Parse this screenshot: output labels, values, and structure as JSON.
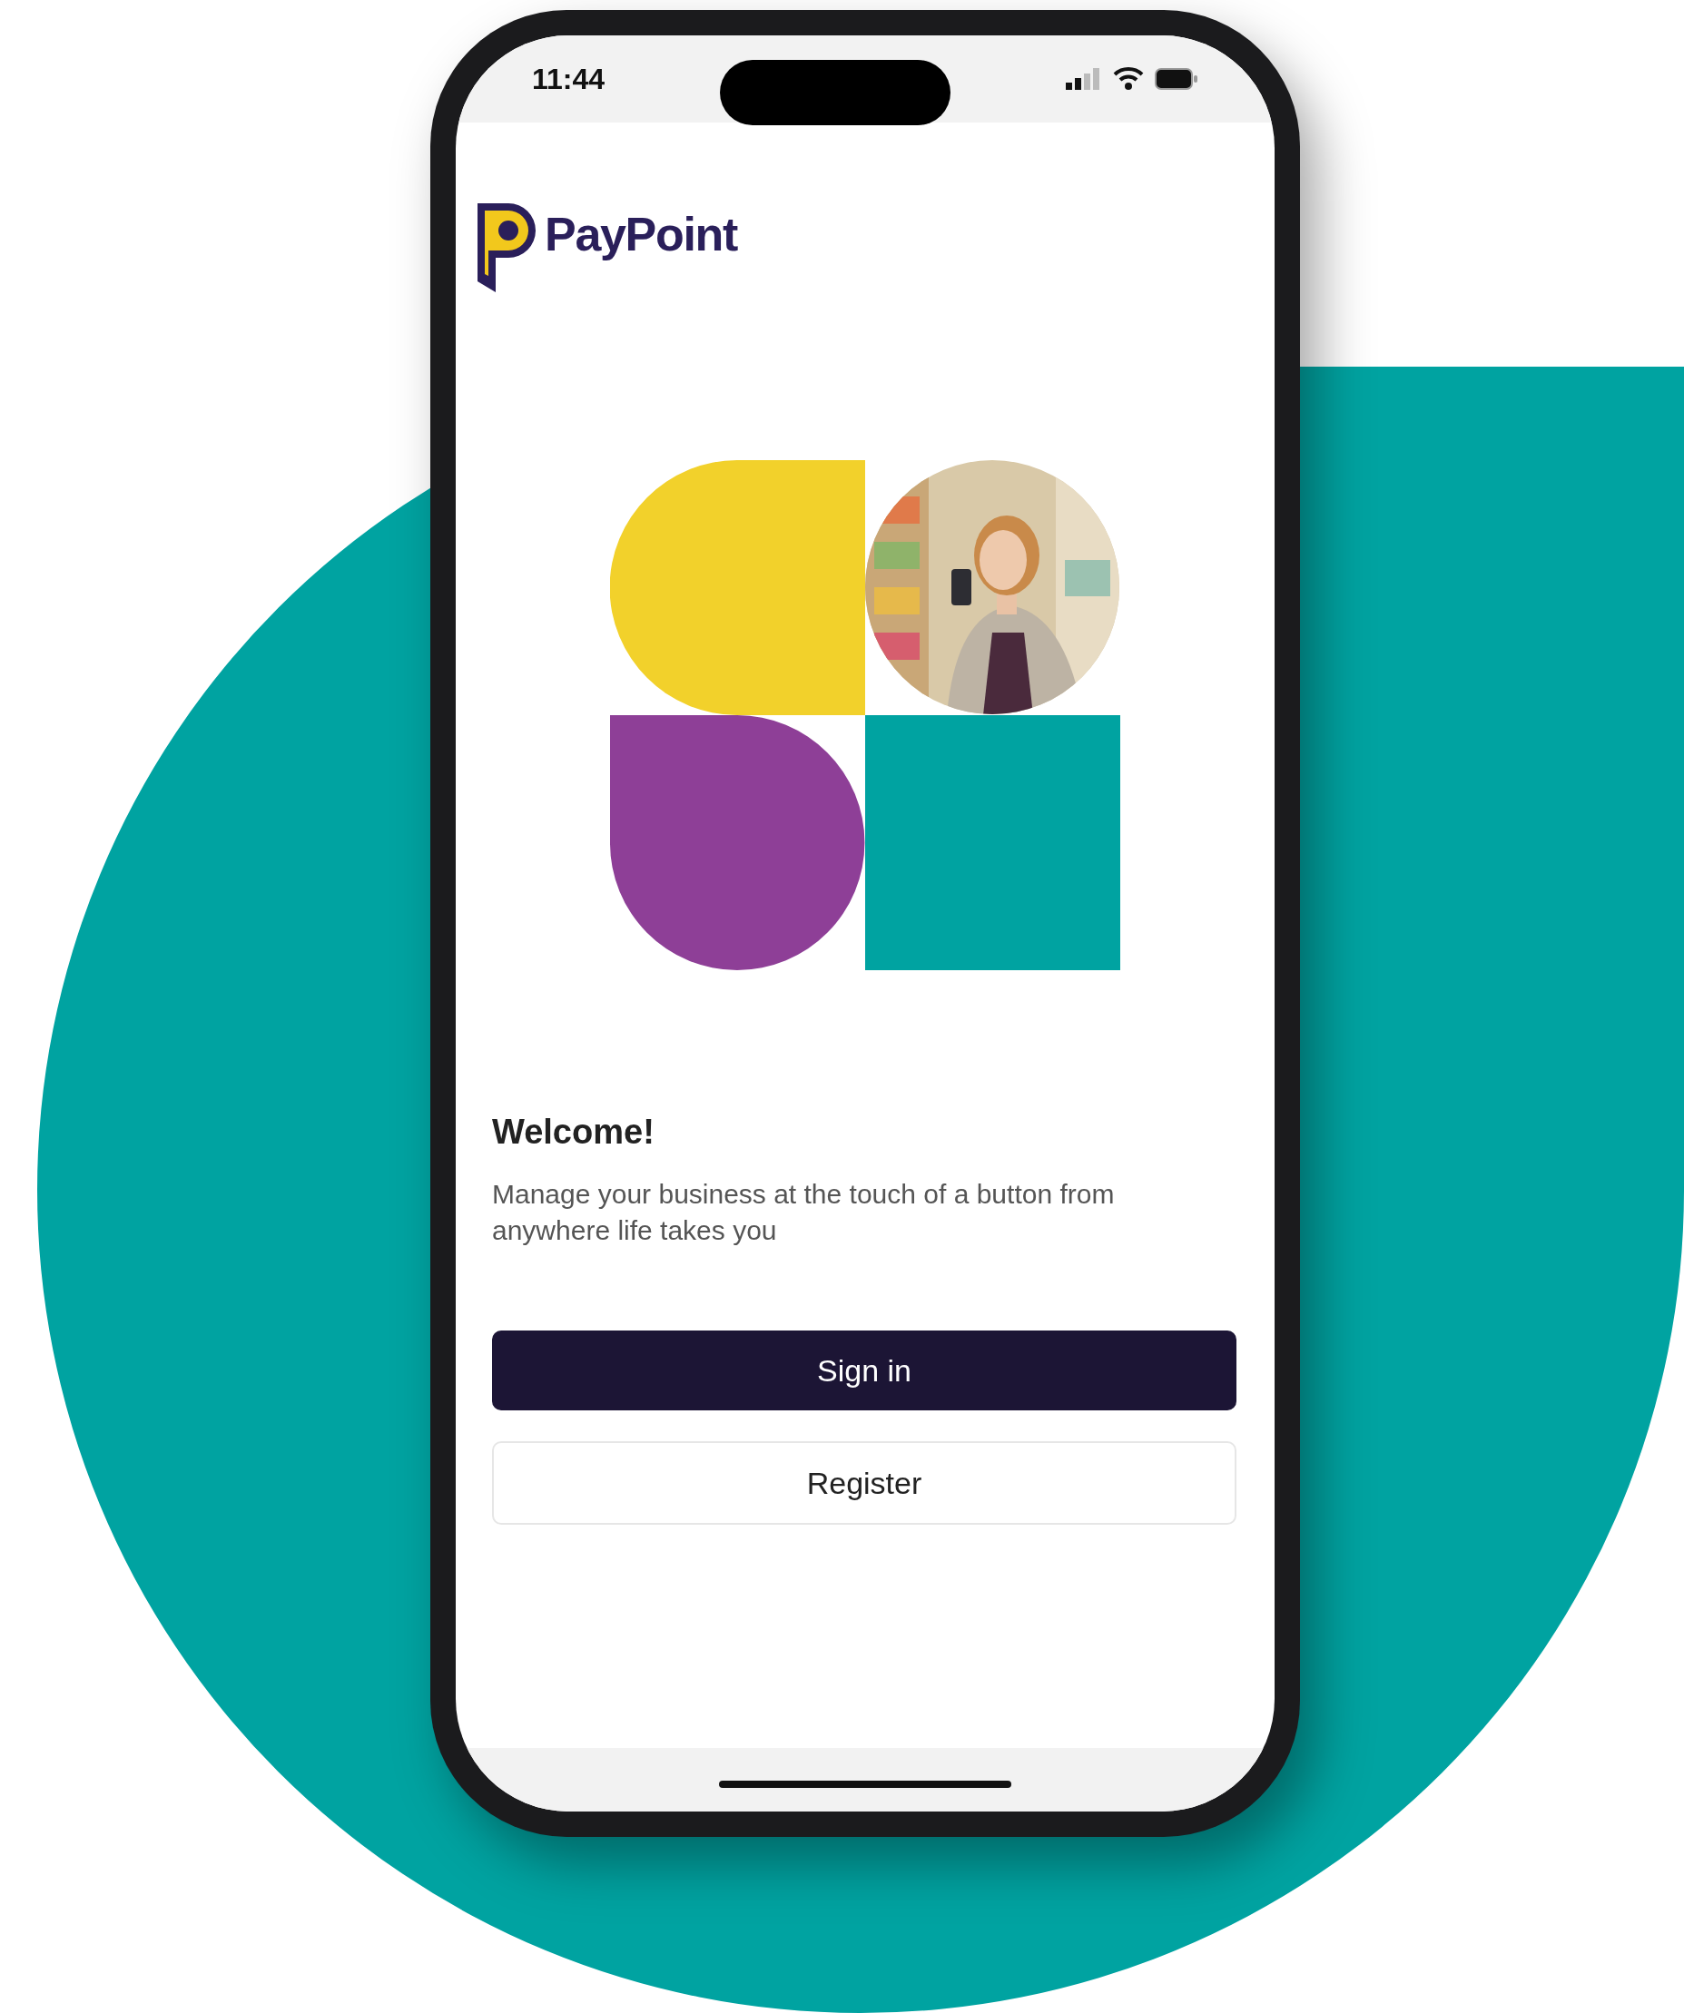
{
  "status_bar": {
    "time": "11:44"
  },
  "logo": {
    "text": "PayPoint"
  },
  "welcome": {
    "title": "Welcome!",
    "message": "Manage your business at the touch of a button from anywhere life takes you"
  },
  "buttons": [
    {
      "label": "Sign in",
      "kind": "primary"
    },
    {
      "label": "Register",
      "kind": "secondary"
    }
  ]
}
